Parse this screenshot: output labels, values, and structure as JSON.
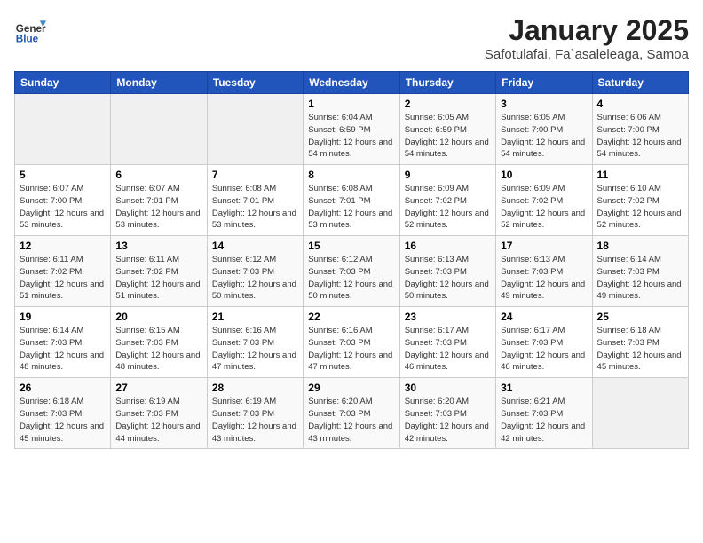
{
  "header": {
    "logo_general": "General",
    "logo_blue": "Blue",
    "title": "January 2025",
    "subtitle": "Safotulafai, Fa`asaleleaga, Samoa"
  },
  "weekdays": [
    "Sunday",
    "Monday",
    "Tuesday",
    "Wednesday",
    "Thursday",
    "Friday",
    "Saturday"
  ],
  "weeks": [
    [
      {
        "day": "",
        "info": ""
      },
      {
        "day": "",
        "info": ""
      },
      {
        "day": "",
        "info": ""
      },
      {
        "day": "1",
        "info": "Sunrise: 6:04 AM\nSunset: 6:59 PM\nDaylight: 12 hours\nand 54 minutes."
      },
      {
        "day": "2",
        "info": "Sunrise: 6:05 AM\nSunset: 6:59 PM\nDaylight: 12 hours\nand 54 minutes."
      },
      {
        "day": "3",
        "info": "Sunrise: 6:05 AM\nSunset: 7:00 PM\nDaylight: 12 hours\nand 54 minutes."
      },
      {
        "day": "4",
        "info": "Sunrise: 6:06 AM\nSunset: 7:00 PM\nDaylight: 12 hours\nand 54 minutes."
      }
    ],
    [
      {
        "day": "5",
        "info": "Sunrise: 6:07 AM\nSunset: 7:00 PM\nDaylight: 12 hours\nand 53 minutes."
      },
      {
        "day": "6",
        "info": "Sunrise: 6:07 AM\nSunset: 7:01 PM\nDaylight: 12 hours\nand 53 minutes."
      },
      {
        "day": "7",
        "info": "Sunrise: 6:08 AM\nSunset: 7:01 PM\nDaylight: 12 hours\nand 53 minutes."
      },
      {
        "day": "8",
        "info": "Sunrise: 6:08 AM\nSunset: 7:01 PM\nDaylight: 12 hours\nand 53 minutes."
      },
      {
        "day": "9",
        "info": "Sunrise: 6:09 AM\nSunset: 7:02 PM\nDaylight: 12 hours\nand 52 minutes."
      },
      {
        "day": "10",
        "info": "Sunrise: 6:09 AM\nSunset: 7:02 PM\nDaylight: 12 hours\nand 52 minutes."
      },
      {
        "day": "11",
        "info": "Sunrise: 6:10 AM\nSunset: 7:02 PM\nDaylight: 12 hours\nand 52 minutes."
      }
    ],
    [
      {
        "day": "12",
        "info": "Sunrise: 6:11 AM\nSunset: 7:02 PM\nDaylight: 12 hours\nand 51 minutes."
      },
      {
        "day": "13",
        "info": "Sunrise: 6:11 AM\nSunset: 7:02 PM\nDaylight: 12 hours\nand 51 minutes."
      },
      {
        "day": "14",
        "info": "Sunrise: 6:12 AM\nSunset: 7:03 PM\nDaylight: 12 hours\nand 50 minutes."
      },
      {
        "day": "15",
        "info": "Sunrise: 6:12 AM\nSunset: 7:03 PM\nDaylight: 12 hours\nand 50 minutes."
      },
      {
        "day": "16",
        "info": "Sunrise: 6:13 AM\nSunset: 7:03 PM\nDaylight: 12 hours\nand 50 minutes."
      },
      {
        "day": "17",
        "info": "Sunrise: 6:13 AM\nSunset: 7:03 PM\nDaylight: 12 hours\nand 49 minutes."
      },
      {
        "day": "18",
        "info": "Sunrise: 6:14 AM\nSunset: 7:03 PM\nDaylight: 12 hours\nand 49 minutes."
      }
    ],
    [
      {
        "day": "19",
        "info": "Sunrise: 6:14 AM\nSunset: 7:03 PM\nDaylight: 12 hours\nand 48 minutes."
      },
      {
        "day": "20",
        "info": "Sunrise: 6:15 AM\nSunset: 7:03 PM\nDaylight: 12 hours\nand 48 minutes."
      },
      {
        "day": "21",
        "info": "Sunrise: 6:16 AM\nSunset: 7:03 PM\nDaylight: 12 hours\nand 47 minutes."
      },
      {
        "day": "22",
        "info": "Sunrise: 6:16 AM\nSunset: 7:03 PM\nDaylight: 12 hours\nand 47 minutes."
      },
      {
        "day": "23",
        "info": "Sunrise: 6:17 AM\nSunset: 7:03 PM\nDaylight: 12 hours\nand 46 minutes."
      },
      {
        "day": "24",
        "info": "Sunrise: 6:17 AM\nSunset: 7:03 PM\nDaylight: 12 hours\nand 46 minutes."
      },
      {
        "day": "25",
        "info": "Sunrise: 6:18 AM\nSunset: 7:03 PM\nDaylight: 12 hours\nand 45 minutes."
      }
    ],
    [
      {
        "day": "26",
        "info": "Sunrise: 6:18 AM\nSunset: 7:03 PM\nDaylight: 12 hours\nand 45 minutes."
      },
      {
        "day": "27",
        "info": "Sunrise: 6:19 AM\nSunset: 7:03 PM\nDaylight: 12 hours\nand 44 minutes."
      },
      {
        "day": "28",
        "info": "Sunrise: 6:19 AM\nSunset: 7:03 PM\nDaylight: 12 hours\nand 43 minutes."
      },
      {
        "day": "29",
        "info": "Sunrise: 6:20 AM\nSunset: 7:03 PM\nDaylight: 12 hours\nand 43 minutes."
      },
      {
        "day": "30",
        "info": "Sunrise: 6:20 AM\nSunset: 7:03 PM\nDaylight: 12 hours\nand 42 minutes."
      },
      {
        "day": "31",
        "info": "Sunrise: 6:21 AM\nSunset: 7:03 PM\nDaylight: 12 hours\nand 42 minutes."
      },
      {
        "day": "",
        "info": ""
      }
    ]
  ]
}
